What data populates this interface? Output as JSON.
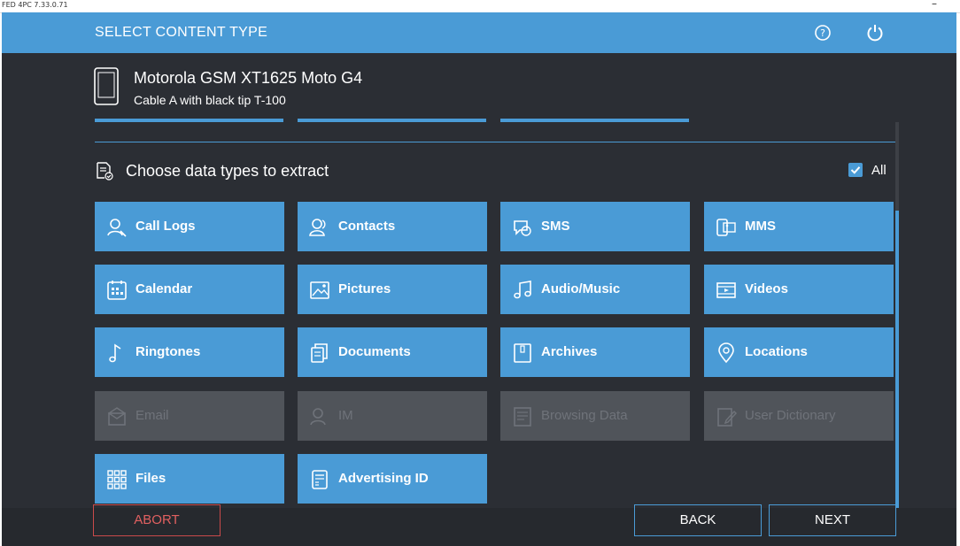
{
  "window": {
    "title": "FED 4PC 7.33.0.71",
    "minimize_glyph": "–"
  },
  "header": {
    "title": "SELECT CONTENT TYPE",
    "help_icon": "question-circle-icon",
    "power_icon": "power-icon"
  },
  "device": {
    "name": "Motorola GSM XT1625 Moto G4",
    "cable": "Cable A with black tip T-100",
    "icon": "phone-icon"
  },
  "section": {
    "title": "Choose data types to extract",
    "all_label": "All",
    "all_checked": true
  },
  "tiles": [
    {
      "label": "Call Logs",
      "icon": "phone-person-icon",
      "enabled": true
    },
    {
      "label": "Contacts",
      "icon": "contacts-icon",
      "enabled": true
    },
    {
      "label": "SMS",
      "icon": "sms-icon",
      "enabled": true
    },
    {
      "label": "MMS",
      "icon": "mms-icon",
      "enabled": true
    },
    {
      "label": "Calendar",
      "icon": "calendar-icon",
      "enabled": true
    },
    {
      "label": "Pictures",
      "icon": "pictures-icon",
      "enabled": true
    },
    {
      "label": "Audio/Music",
      "icon": "music-icon",
      "enabled": true
    },
    {
      "label": "Videos",
      "icon": "video-icon",
      "enabled": true
    },
    {
      "label": "Ringtones",
      "icon": "note-icon",
      "enabled": true
    },
    {
      "label": "Documents",
      "icon": "documents-icon",
      "enabled": true
    },
    {
      "label": "Archives",
      "icon": "archive-icon",
      "enabled": true
    },
    {
      "label": "Locations",
      "icon": "location-pin-icon",
      "enabled": true
    },
    {
      "label": "Email",
      "icon": "email-icon",
      "enabled": false
    },
    {
      "label": "IM",
      "icon": "im-icon",
      "enabled": false
    },
    {
      "label": "Browsing Data",
      "icon": "browsing-icon",
      "enabled": false
    },
    {
      "label": "User Dictionary",
      "icon": "dictionary-icon",
      "enabled": false
    },
    {
      "label": "Files",
      "icon": "grid-icon",
      "enabled": true
    },
    {
      "label": "Advertising ID",
      "icon": "id-card-icon",
      "enabled": true
    }
  ],
  "footer": {
    "abort": "ABORT",
    "back": "BACK",
    "next": "NEXT"
  },
  "colors": {
    "accent": "#4a9bd6",
    "background": "#2b2e34",
    "disabled": "#50545a",
    "abort": "#c94a4a"
  }
}
